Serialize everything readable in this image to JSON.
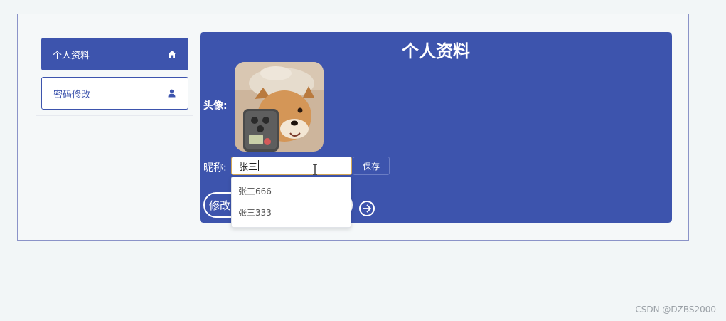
{
  "sidebar": {
    "items": [
      {
        "label": "个人资料",
        "icon": "home-icon",
        "active": true
      },
      {
        "label": "密码修改",
        "icon": "user-icon",
        "active": false
      }
    ]
  },
  "profile": {
    "title": "个人资料",
    "avatar_label": "头像:",
    "nickname_label": "昵称:",
    "nickname_value": "张三",
    "save_label": "保存",
    "edit_label": "修改"
  },
  "autocomplete": {
    "options": [
      "张三666",
      "张三333"
    ]
  },
  "watermark": "CSDN @DZBS2000",
  "colors": {
    "accent": "#3d54ad",
    "background": "#f2f6f7",
    "input_focus_border": "#d4a857"
  }
}
